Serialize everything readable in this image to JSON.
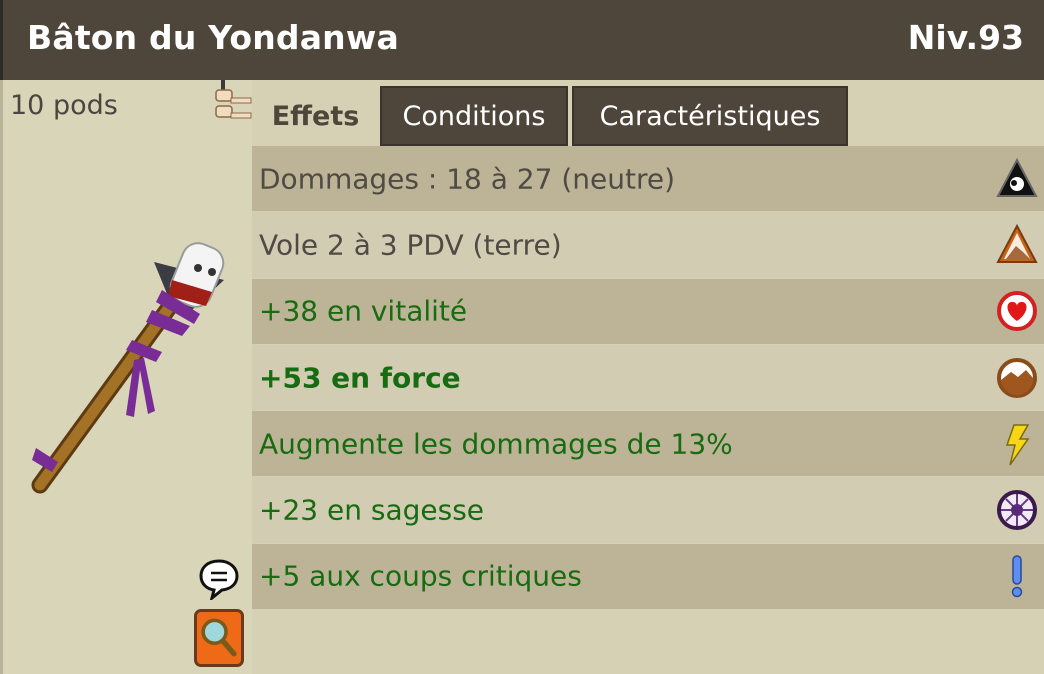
{
  "header": {
    "title": "Bâton du Yondanwa",
    "level": "Niv.93"
  },
  "item": {
    "weight": "10 pods"
  },
  "tabs": [
    {
      "label": "Effets",
      "active": true
    },
    {
      "label": "Conditions",
      "active": false
    },
    {
      "label": "Caractéristiques",
      "active": false
    }
  ],
  "effects": [
    {
      "text": "Dommages : 18 à 27 (neutre)",
      "color": "#4f4a44",
      "icon": "neutral-icon"
    },
    {
      "text": "Vole 2 à 3 PDV (terre)",
      "color": "#4f4a44",
      "icon": "earth-icon"
    },
    {
      "text": "+38 en vitalité",
      "color": "#176b10",
      "icon": "vitality-icon"
    },
    {
      "text": "+53 en force",
      "color": "#176b10",
      "icon": "strength-icon"
    },
    {
      "text": "Augmente les dommages de 13%",
      "color": "#176b10",
      "icon": "damage-icon"
    },
    {
      "text": "+23 en sagesse",
      "color": "#176b10",
      "icon": "wisdom-icon"
    },
    {
      "text": "+5 aux coups critiques",
      "color": "#176b10",
      "icon": "critical-icon"
    }
  ],
  "colors": {
    "header_bg": "#4e463b",
    "panel_bg": "#d6d1b5",
    "bonus_text": "#176b10",
    "neutral_text": "#4f4a44"
  }
}
